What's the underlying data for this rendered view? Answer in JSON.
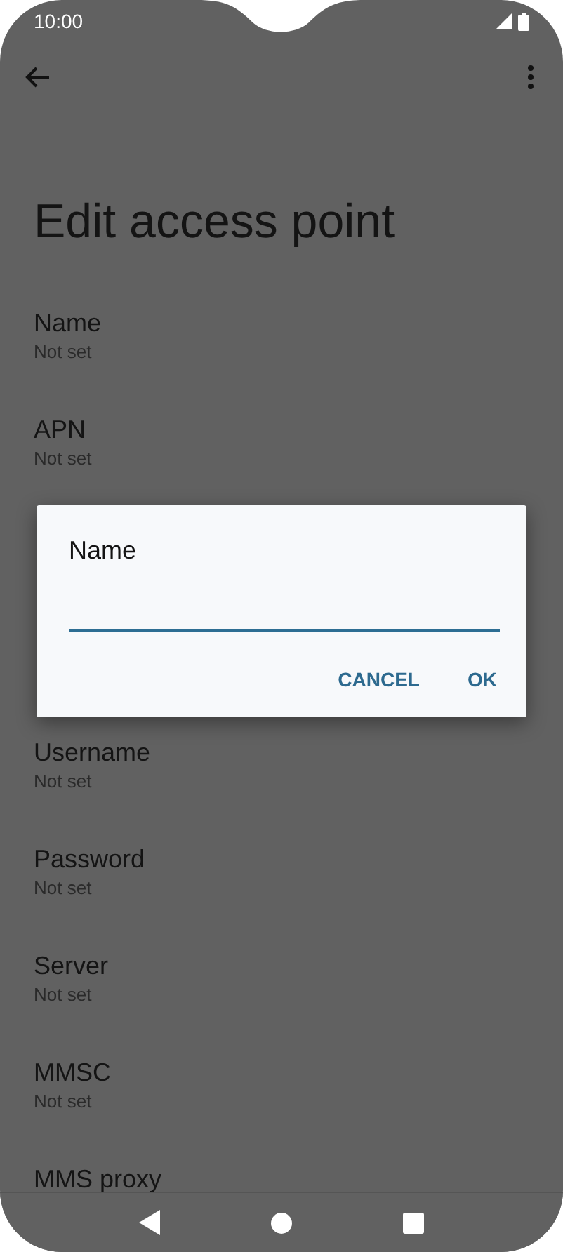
{
  "status_bar": {
    "time": "10:00"
  },
  "title": "Edit access point",
  "settings": [
    {
      "label": "Name",
      "value": "Not set"
    },
    {
      "label": "APN",
      "value": "Not set"
    },
    {
      "label": "Username",
      "value": "Not set"
    },
    {
      "label": "Password",
      "value": "Not set"
    },
    {
      "label": "Server",
      "value": "Not set"
    },
    {
      "label": "MMSC",
      "value": "Not set"
    },
    {
      "label": "MMS proxy"
    }
  ],
  "dialog": {
    "title": "Name",
    "buttons": [
      "CANCEL",
      "OK"
    ]
  }
}
